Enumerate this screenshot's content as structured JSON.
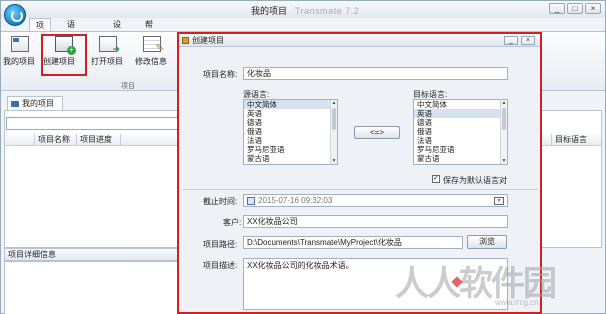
{
  "window": {
    "title": "我的项目",
    "app_name": "Transmate 7.2",
    "controls": [
      "_",
      "□",
      "×"
    ]
  },
  "menu": {
    "items": [
      "项目",
      "语料管理",
      "设置",
      "帮助"
    ],
    "active": "项目"
  },
  "ribbon": {
    "buttons": [
      {
        "label": "我的项目",
        "icon": "my-projects-icon"
      },
      {
        "label": "创建项目",
        "icon": "create-project-icon",
        "highlighted": true
      },
      {
        "label": "打开项目",
        "icon": "open-project-icon"
      },
      {
        "label": "修改信息",
        "icon": "edit-info-icon"
      }
    ],
    "group_label": "项目"
  },
  "workspace": {
    "tab": "我的项目",
    "columns": [
      "项目名称",
      "项目进度"
    ],
    "right_column": "目标语言",
    "detail_panel": "项目详细信息"
  },
  "dialog": {
    "title": "创建项目",
    "controls": [
      "_",
      "×"
    ],
    "name_label": "项目名称:",
    "name_value": "化妆品",
    "source_label": "源语言:",
    "target_label": "目标语言:",
    "source_languages": [
      "中文简体",
      "英语",
      "德语",
      "俄语",
      "法语",
      "罗马尼亚语",
      "蒙古语"
    ],
    "target_languages": [
      "中文简体",
      "英语",
      "德语",
      "俄语",
      "法语",
      "罗马尼亚语",
      "蒙古语"
    ],
    "source_selected": "中文简体",
    "target_selected": "英语",
    "swap_label": "<=>",
    "save_default_label": "保存为默认语言对",
    "save_default_checked": true,
    "deadline_label": "截止时间:",
    "deadline_value": "2015-07-16 09:32:03",
    "client_label": "客户:",
    "client_value": "XX化妆品公司",
    "path_label": "项目路径:",
    "path_value": "D:\\Documents\\Transmate\\MyProject\\化妆品",
    "browse_label": "浏览",
    "desc_label": "项目描述:",
    "desc_value": "XX化妆品公司的化妆品术语。"
  },
  "colors": {
    "highlight": "#d21f1f",
    "ribbon_bg": "#e8edf3",
    "dialog_bg": "#eef2f7"
  }
}
